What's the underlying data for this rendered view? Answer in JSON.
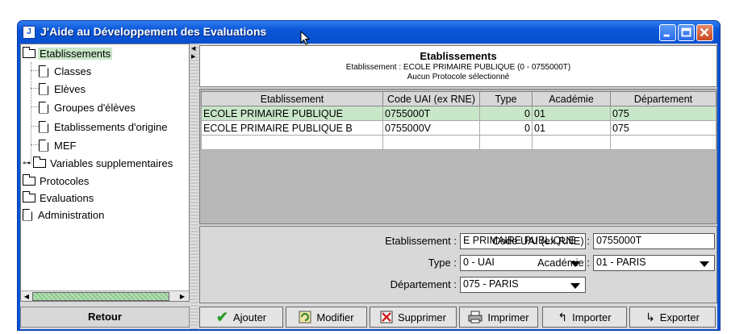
{
  "window": {
    "title": "J'Aide au Développement des Evaluations",
    "app_icon_text": "J"
  },
  "tree": {
    "items": [
      {
        "label": "Etablissements",
        "icon": "folder-icon"
      },
      {
        "label": "Classes",
        "icon": "document-icon"
      },
      {
        "label": "Elèves",
        "icon": "document-icon"
      },
      {
        "label": "Groupes d'élèves",
        "icon": "document-icon"
      },
      {
        "label": "Etablissements d'origine",
        "icon": "document-icon"
      },
      {
        "label": "MEF",
        "icon": "document-icon"
      },
      {
        "label": "Variables supplementaires",
        "icon": "folder-icon"
      },
      {
        "label": "Protocoles",
        "icon": "folder-icon"
      },
      {
        "label": "Evaluations",
        "icon": "folder-icon"
      },
      {
        "label": "Administration",
        "icon": "document-icon"
      }
    ]
  },
  "retour_label": "Retour",
  "header": {
    "title": "Etablissements",
    "line1": "Etablissement : ECOLE PRIMAIRE PUBLIQUE  (0 - 0755000T)",
    "line2": "Aucun Protocole sélectionné"
  },
  "table": {
    "columns": [
      "Etablissement",
      "Code UAI (ex RNE)",
      "Type",
      "Académie",
      "Département"
    ],
    "rows": [
      [
        "ECOLE PRIMAIRE PUBLIQUE",
        "0755000T",
        "0",
        "01",
        "075"
      ],
      [
        "ECOLE PRIMAIRE PUBLIQUE B",
        "0755000V",
        "0",
        "01",
        "075"
      ]
    ]
  },
  "form": {
    "etablissement_label": "Etablissement :",
    "etablissement_value": "E PRIMAIRE PUBLIQUE",
    "code_label": "Code UAI (ex RNE) :",
    "code_value": "0755000T",
    "type_label": "Type :",
    "type_value": "0 - UAI",
    "academie_label": "Académie :",
    "academie_value": "01 - PARIS",
    "departement_label": "Département :",
    "departement_value": "075 - PARIS"
  },
  "toolbar": {
    "ajouter": "Ajouter",
    "modifier": "Modifier",
    "supprimer": "Supprimer",
    "imprimer": "Imprimer",
    "importer": "Importer",
    "exporter": "Exporter"
  },
  "colors": {
    "title_bar": "#0a55d8",
    "selection": "#c8e6c8"
  }
}
